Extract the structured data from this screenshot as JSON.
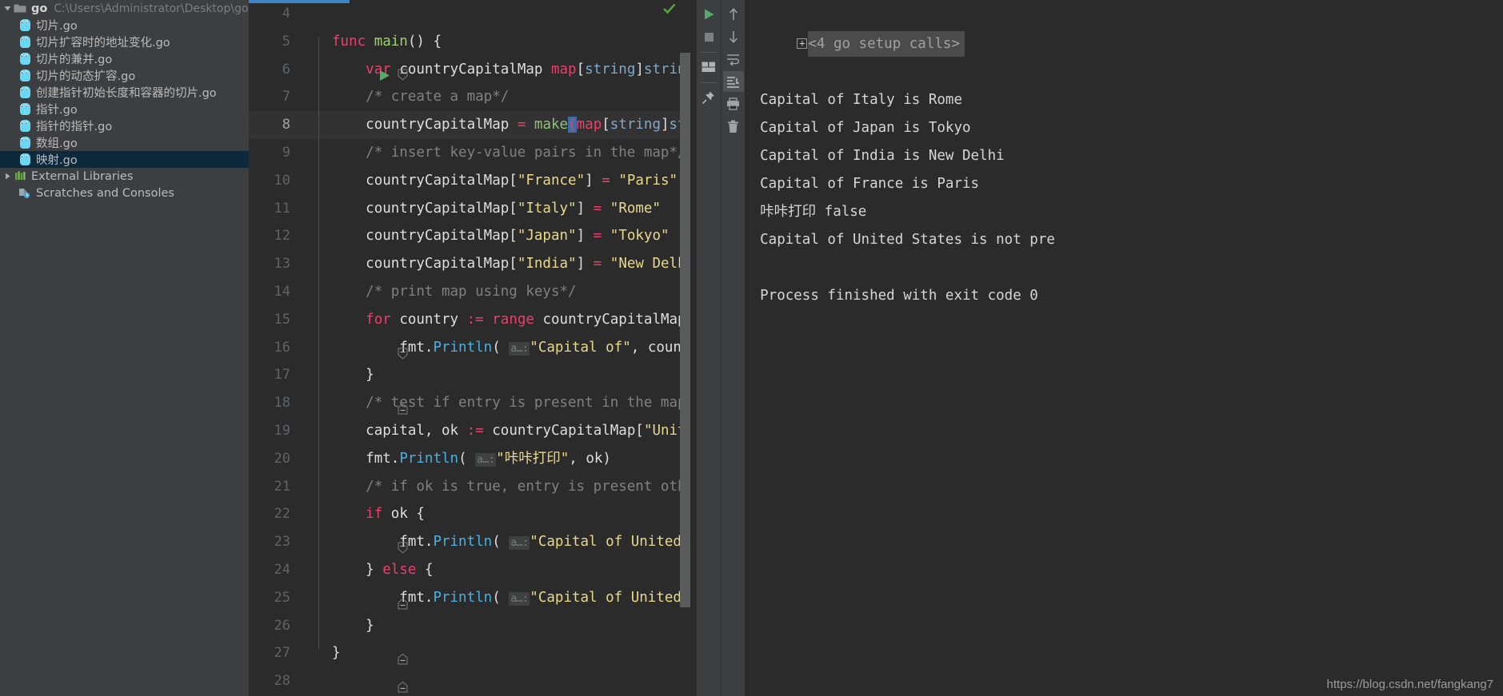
{
  "project": {
    "root": {
      "label": "go",
      "path": "C:\\Users\\Administrator\\Desktop\\go",
      "icon": "folder-icon",
      "expanded": true
    },
    "files": [
      {
        "label": "切片.go",
        "icon": "go-file-icon"
      },
      {
        "label": "切片扩容时的地址变化.go",
        "icon": "go-file-icon"
      },
      {
        "label": "切片的兼并.go",
        "icon": "go-file-icon"
      },
      {
        "label": "切片的动态扩容.go",
        "icon": "go-file-icon"
      },
      {
        "label": "创建指针初始长度和容器的切片.go",
        "icon": "go-file-icon"
      },
      {
        "label": "指针.go",
        "icon": "go-file-icon"
      },
      {
        "label": "指针的指针.go",
        "icon": "go-file-icon"
      },
      {
        "label": "数组.go",
        "icon": "go-file-icon"
      },
      {
        "label": "映射.go",
        "icon": "go-file-icon",
        "selected": true
      }
    ],
    "external_libraries": {
      "label": "External Libraries",
      "icon": "libraries-icon",
      "expanded": false
    },
    "scratches": {
      "label": "Scratches and Consoles",
      "icon": "scratches-icon"
    }
  },
  "editor": {
    "first_line": 4,
    "current_line": 8,
    "run_marker_line": 5,
    "status_icon": "green-check-icon",
    "lines": [
      {
        "num": "4",
        "text": ""
      },
      {
        "num": "5",
        "text": "func main() {"
      },
      {
        "num": "6",
        "text": "    var countryCapitalMap map[string]string"
      },
      {
        "num": "7",
        "text": "    /* create a map*/"
      },
      {
        "num": "8",
        "text": "    countryCapitalMap = make(map[string]string)"
      },
      {
        "num": "9",
        "text": "    /* insert key-value pairs in the map*/"
      },
      {
        "num": "10",
        "text": "    countryCapitalMap[\"France\"] = \"Paris\""
      },
      {
        "num": "11",
        "text": "    countryCapitalMap[\"Italy\"] = \"Rome\""
      },
      {
        "num": "12",
        "text": "    countryCapitalMap[\"Japan\"] = \"Tokyo\""
      },
      {
        "num": "13",
        "text": "    countryCapitalMap[\"India\"] = \"New Delhi\""
      },
      {
        "num": "14",
        "text": "    /* print map using keys*/"
      },
      {
        "num": "15",
        "text": "    for country := range countryCapitalMap {"
      },
      {
        "num": "16",
        "text": "        fmt.Println( a…: \"Capital of\", country, \"is\", countryCapitalMap[co"
      },
      {
        "num": "17",
        "text": "    }"
      },
      {
        "num": "18",
        "text": "    /* test if entry is present in the map or not*/"
      },
      {
        "num": "19",
        "text": "    capital, ok := countryCapitalMap[\"United States\"]"
      },
      {
        "num": "20",
        "text": "    fmt.Println( a…: \"咔咔打印\", ok)"
      },
      {
        "num": "21",
        "text": "    /* if ok is true, entry is present otherwise entry is absent*/"
      },
      {
        "num": "22",
        "text": "    if ok {"
      },
      {
        "num": "23",
        "text": "        fmt.Println( a…: \"Capital of United States is\", capital)"
      },
      {
        "num": "24",
        "text": "    } else {"
      },
      {
        "num": "25",
        "text": "        fmt.Println( a…: \"Capital of United States is not present\")"
      },
      {
        "num": "26",
        "text": "    }"
      },
      {
        "num": "27",
        "text": "}"
      },
      {
        "num": "28",
        "text": ""
      }
    ],
    "parameter_hint": "a…:"
  },
  "run_toolbar": {
    "left": [
      {
        "name": "rerun-button",
        "icon": "play-icon",
        "label": "Rerun"
      },
      {
        "name": "stop-button",
        "icon": "stop-icon",
        "label": "Stop"
      },
      {
        "name": "layout-button",
        "icon": "layout-icon",
        "label": "Layout Settings"
      },
      {
        "name": "pin-tab-button",
        "icon": "pin-icon",
        "label": "Pin Tab"
      }
    ],
    "right": [
      {
        "name": "up-stack-button",
        "icon": "arrow-up-icon",
        "label": "Up the Stack Trace"
      },
      {
        "name": "down-stack-button",
        "icon": "arrow-down-icon",
        "label": "Down the Stack Trace"
      },
      {
        "name": "soft-wrap-button",
        "icon": "soft-wrap-icon",
        "label": "Soft-Wrap"
      },
      {
        "name": "scroll-to-end-button",
        "icon": "scroll-to-end-icon",
        "label": "Scroll to the End",
        "active": true
      },
      {
        "name": "print-button",
        "icon": "print-icon",
        "label": "Print"
      },
      {
        "name": "clear-all-button",
        "icon": "trash-icon",
        "label": "Clear All"
      }
    ]
  },
  "console": {
    "fold_header": "<4 go setup calls>",
    "lines": [
      "Capital of Italy is Rome",
      "Capital of Japan is Tokyo",
      "Capital of India is New Delhi",
      "Capital of France is Paris",
      "咔咔打印 false",
      "Capital of United States is not pre",
      "",
      "Process finished with exit code 0"
    ]
  },
  "watermark": "https://blog.csdn.net/fangkang7"
}
